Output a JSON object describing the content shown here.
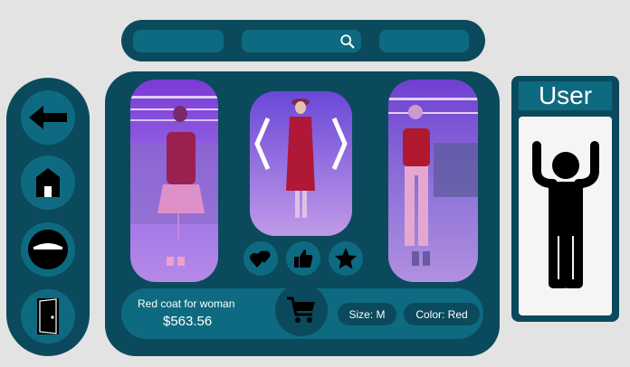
{
  "top_bar": {
    "search_icon": "search-icon"
  },
  "left_nav": {
    "items": [
      {
        "name": "back",
        "icon": "arrow-left-icon"
      },
      {
        "name": "home",
        "icon": "house-icon"
      },
      {
        "name": "view",
        "icon": "eye-icon"
      },
      {
        "name": "exit",
        "icon": "door-exit-icon"
      }
    ]
  },
  "gallery": {
    "left_photo": "mannequin in red top and pink pleated skirt",
    "middle_photo": "mannequin in red coat with hat",
    "right_photo": "mannequin in red blouse and pink trousers",
    "actions": [
      {
        "name": "love",
        "icon": "hearts-icon"
      },
      {
        "name": "like",
        "icon": "thumbs-up-icon"
      },
      {
        "name": "favorite",
        "icon": "star-icon"
      }
    ]
  },
  "product": {
    "name": "Red coat for woman",
    "price": "$563.56",
    "size_label": "Size: M",
    "color_label": "Color: Red",
    "cart_icon": "cart-icon"
  },
  "user_panel": {
    "title": "User",
    "avatar_icon": "person-icon"
  },
  "colors": {
    "panel": "#0b4a5c",
    "accent": "#0e6a80",
    "background": "#e3e3e3"
  }
}
